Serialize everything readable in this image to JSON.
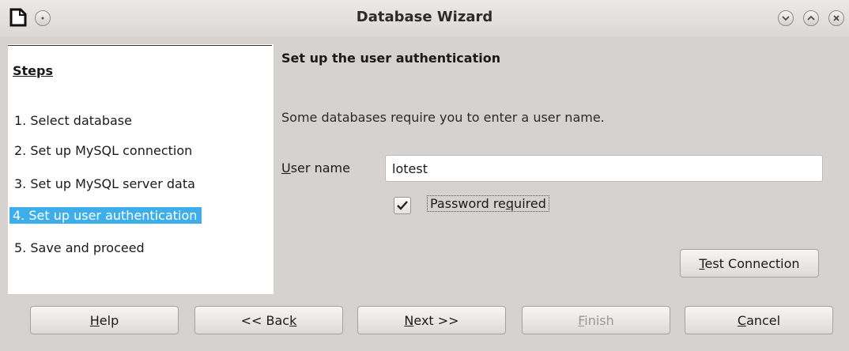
{
  "window": {
    "title": "Database Wizard"
  },
  "steps": {
    "heading": "Steps",
    "items": [
      {
        "label": "1. Select database",
        "active": false
      },
      {
        "label": "2. Set up MySQL connection",
        "active": false
      },
      {
        "label": "3. Set up MySQL server data",
        "active": false
      },
      {
        "label": "4. Set up user authentication",
        "active": true
      },
      {
        "label": "5. Save and proceed",
        "active": false
      }
    ]
  },
  "main": {
    "section_title": "Set up the user authentication",
    "description": "Some databases require you to enter a user name.",
    "user_name_label": "User name",
    "user_name_value": "lotest",
    "password_required_label": "Password required",
    "password_required_checked": true,
    "test_connection_label": "Test Connection"
  },
  "buttons": {
    "help": "Help",
    "back": "<< Back",
    "next": "Next >>",
    "finish": "Finish",
    "cancel": "Cancel"
  },
  "colors": {
    "selection": "#3daee9",
    "window_bg": "#d6d2d0"
  }
}
